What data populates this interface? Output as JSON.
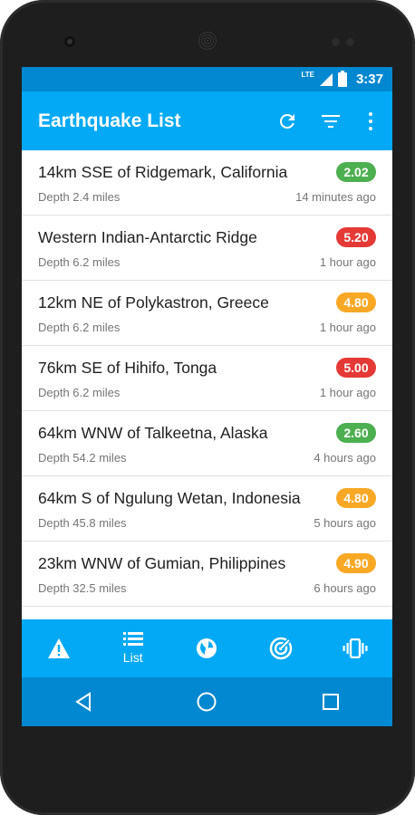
{
  "status_bar": {
    "network": "LTE",
    "time": "3:37"
  },
  "app_bar": {
    "title": "Earthquake List"
  },
  "colors": {
    "green": "#4caf50",
    "red": "#e53935",
    "orange": "#f9a825",
    "primary": "#03a9f4",
    "primary_dark": "#0288d1"
  },
  "quakes": [
    {
      "place": "14km SSE of Ridgemark, California",
      "magnitude": "2.02",
      "depth": "Depth 2.4 miles",
      "time": "14 minutes ago",
      "color": "#4caf50"
    },
    {
      "place": "Western Indian-Antarctic Ridge",
      "magnitude": "5.20",
      "depth": "Depth 6.2 miles",
      "time": "1 hour ago",
      "color": "#e53935"
    },
    {
      "place": "12km NE of Polykastron, Greece",
      "magnitude": "4.80",
      "depth": "Depth 6.2 miles",
      "time": "1 hour ago",
      "color": "#f9a825"
    },
    {
      "place": "76km SE of Hihifo, Tonga",
      "magnitude": "5.00",
      "depth": "Depth 6.2 miles",
      "time": "1 hour ago",
      "color": "#e53935"
    },
    {
      "place": "64km WNW of Talkeetna, Alaska",
      "magnitude": "2.60",
      "depth": "Depth 54.2 miles",
      "time": "4 hours ago",
      "color": "#4caf50"
    },
    {
      "place": "64km S of Ngulung Wetan, Indonesia",
      "magnitude": "4.80",
      "depth": "Depth 45.8 miles",
      "time": "5 hours ago",
      "color": "#f9a825"
    },
    {
      "place": "23km WNW of Gumian, Philippines",
      "magnitude": "4.90",
      "depth": "Depth 32.5 miles",
      "time": "6 hours ago",
      "color": "#f9a825"
    }
  ],
  "bottom_nav": {
    "items": [
      {
        "icon": "warning-icon",
        "label": ""
      },
      {
        "icon": "list-icon",
        "label": "List"
      },
      {
        "icon": "globe-icon",
        "label": ""
      },
      {
        "icon": "radar-icon",
        "label": ""
      },
      {
        "icon": "vibrate-icon",
        "label": ""
      }
    ]
  }
}
